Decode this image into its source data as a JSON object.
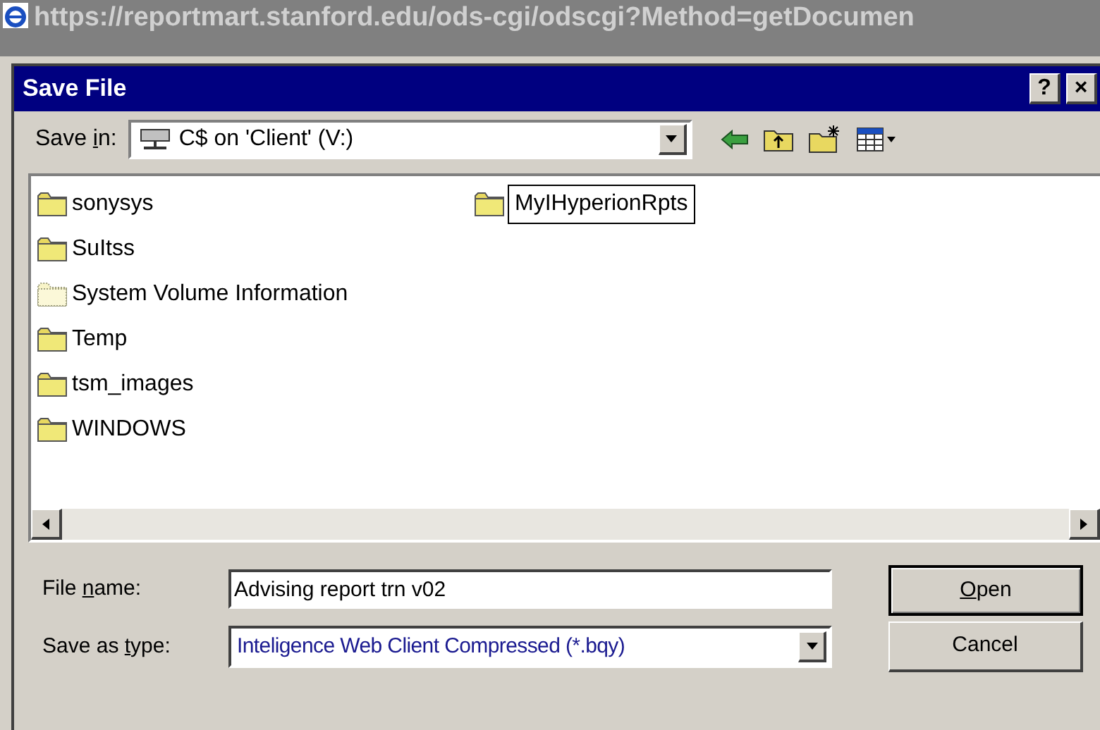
{
  "browser_title": "https://reportmart.stanford.edu/ods-cgi/odscgi?Method=getDocumen",
  "dialog": {
    "title": "Save File",
    "title_buttons": [
      "?",
      "×"
    ]
  },
  "save_in": {
    "label_parts": [
      "Save ",
      "i",
      "n:"
    ],
    "value": "C$ on 'Client' (V:)"
  },
  "files": [
    {
      "name": "sonysys",
      "kind": "folder",
      "selected": false
    },
    {
      "name": "SuItss",
      "kind": "folder",
      "selected": false
    },
    {
      "name": "System Volume Information",
      "kind": "hidden",
      "selected": false
    },
    {
      "name": "Temp",
      "kind": "folder",
      "selected": false
    },
    {
      "name": "tsm_images",
      "kind": "folder",
      "selected": false
    },
    {
      "name": "WINDOWS",
      "kind": "folder",
      "selected": false
    },
    {
      "name": "MyIHyperionRpts",
      "kind": "folder",
      "selected": true
    }
  ],
  "file_name": {
    "label_parts": [
      "File ",
      "n",
      "ame:"
    ],
    "value": "Advising report trn v02"
  },
  "save_as_type": {
    "label_parts": [
      "Save as ",
      "t",
      "ype:"
    ],
    "value": "Inteligence Web Client Compressed (*.bqy)"
  },
  "buttons": [
    {
      "key": "O",
      "after": "pen",
      "default": true
    },
    {
      "before": "Cancel",
      "default": false
    }
  ]
}
